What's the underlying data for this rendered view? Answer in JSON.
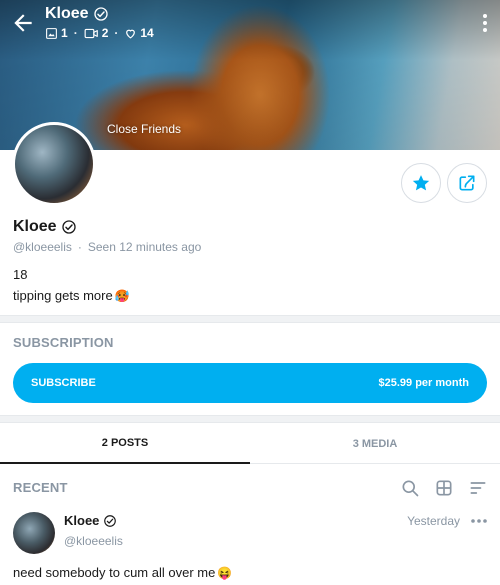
{
  "header": {
    "title": "Kloee",
    "stats": {
      "images": "1",
      "videos": "2",
      "likes": "14"
    },
    "close_friends_label": "Close Friends"
  },
  "profile": {
    "name": "Kloee",
    "handle": "@kloeeelis",
    "separator": "·",
    "seen": "Seen  12 minutes ago",
    "bio_line1": "18",
    "bio_line2": "tipping gets more",
    "bio_emoji": "🥵"
  },
  "subscription": {
    "section_title": "SUBSCRIPTION",
    "button_label": "SUBSCRIBE",
    "price": "$25.99 per month"
  },
  "tabs": [
    {
      "label": "2 POSTS"
    },
    {
      "label": "3 MEDIA"
    }
  ],
  "recent": {
    "section_title": "RECENT"
  },
  "post": {
    "name": "Kloee",
    "handle": "@kloeeelis",
    "time": "Yesterday",
    "text": "need somebody to cum all over me",
    "emoji": "😝"
  },
  "colors": {
    "accent": "#00aff0",
    "muted": "#8a96a3",
    "text": "#1a1a1a"
  },
  "icons": {
    "back": "arrow-left-icon",
    "verified": "verified-check-icon",
    "image": "image-icon",
    "video": "video-icon",
    "like": "heart-icon",
    "more": "more-vertical-icon",
    "favorite": "star-icon",
    "share": "share-icon",
    "search": "search-icon",
    "grid": "grid-icon",
    "sort": "sort-icon",
    "post_more": "more-horizontal-icon"
  }
}
